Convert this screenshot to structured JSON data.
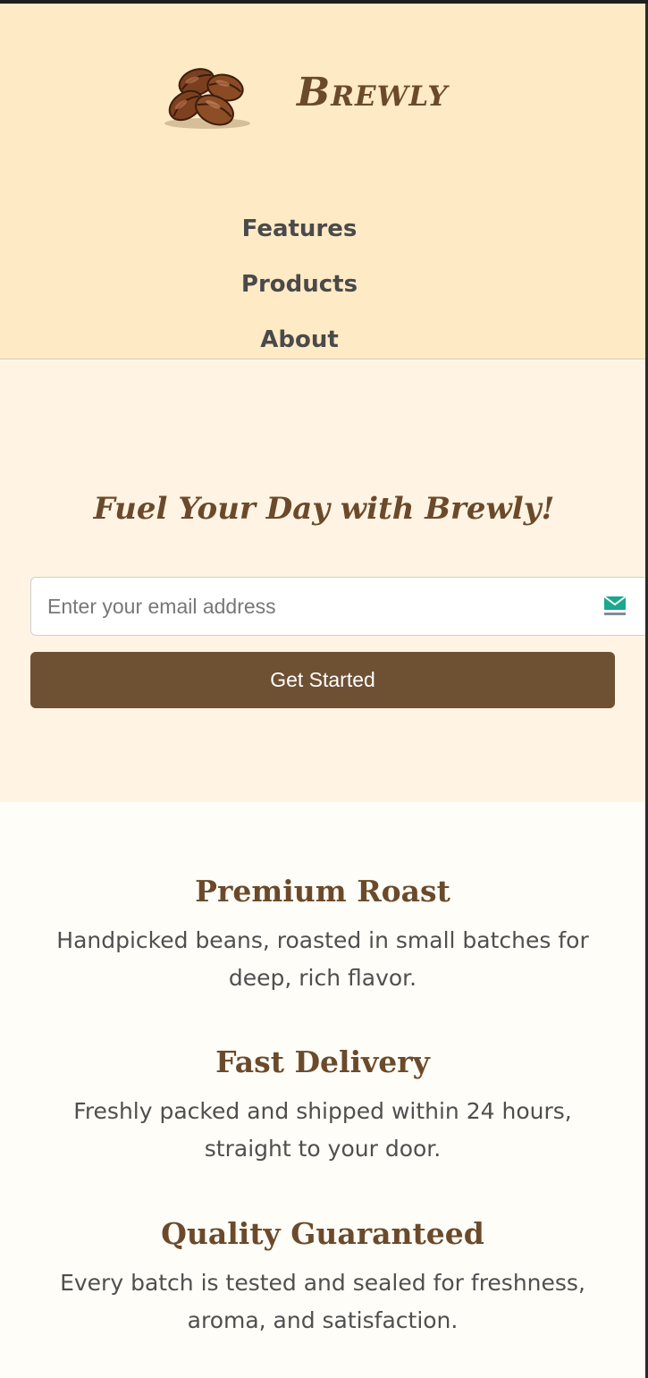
{
  "brand": {
    "name": "Brewly",
    "logo_icon": "coffee-beans-icon"
  },
  "nav": {
    "items": [
      {
        "label": "Features"
      },
      {
        "label": "Products"
      },
      {
        "label": "About"
      }
    ]
  },
  "hero": {
    "title": "Fuel Your Day with Brewly!",
    "email_placeholder": "Enter your email address",
    "email_value": "",
    "email_addon_icon": "tempmail-icon",
    "cta_label": "Get Started"
  },
  "features": [
    {
      "title": "Premium Roast",
      "description": "Handpicked beans, roasted in small batches for deep, rich flavor."
    },
    {
      "title": "Fast Delivery",
      "description": "Freshly packed and shipped within 24 hours, straight to your door."
    },
    {
      "title": "Quality Guaranteed",
      "description": "Every batch is tested and sealed for freshness, aroma, and satisfaction."
    }
  ],
  "colors": {
    "header_bg": "#ffeac6",
    "hero_bg": "#fff4e3",
    "page_bg": "#fffdf7",
    "accent_brown": "#6b4a2b",
    "button_bg": "#6e5033"
  }
}
